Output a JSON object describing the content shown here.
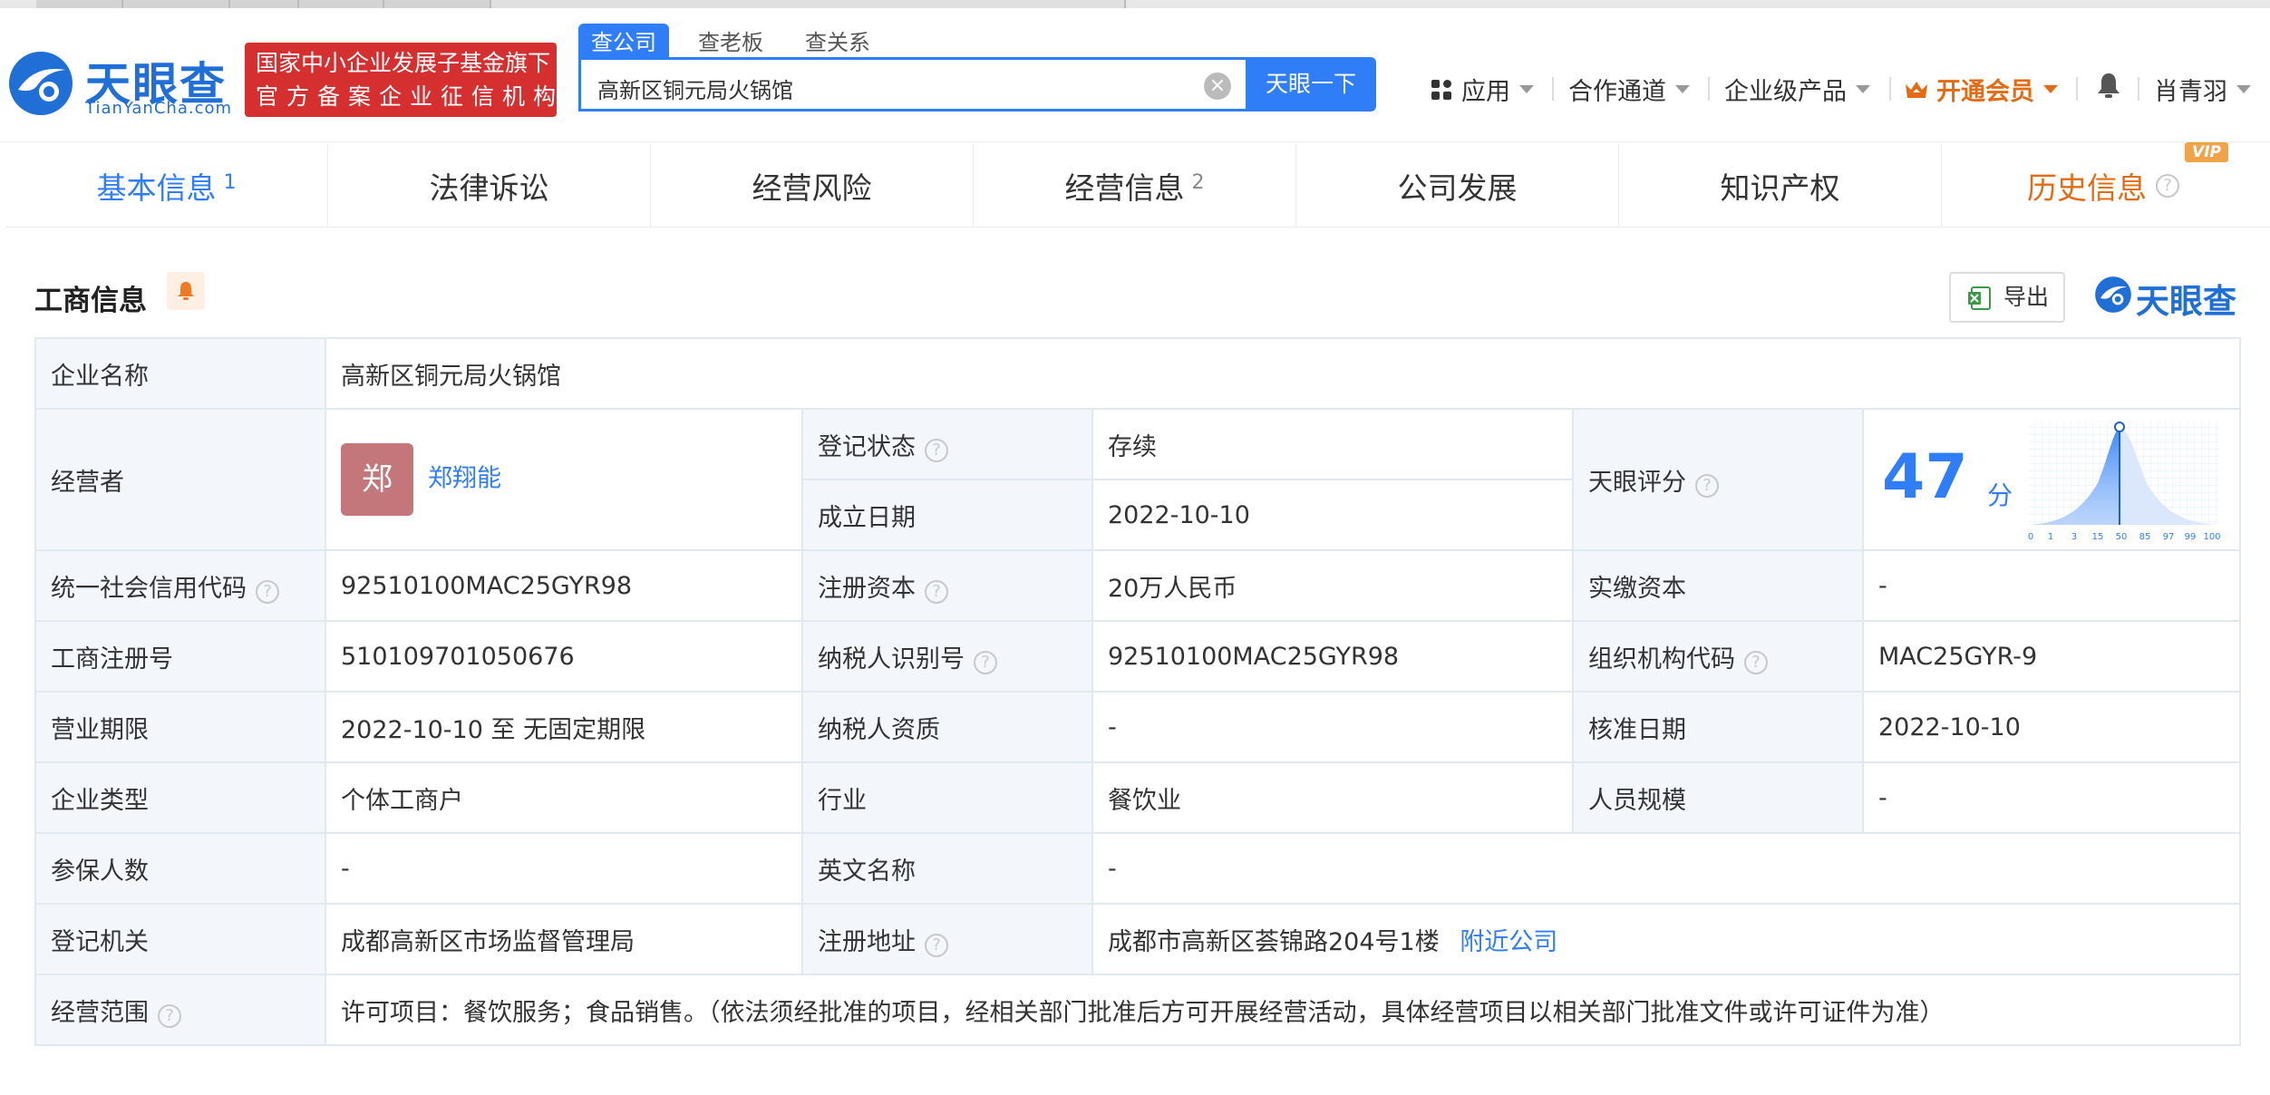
{
  "header": {
    "logo_text": "天眼查",
    "logo_sub": "TianYanCha.com",
    "badge_line1": "国家中小企业发展子基金旗下",
    "badge_line2": "官方备案企业征信机构",
    "search_tabs": [
      "查公司",
      "查老板",
      "查关系"
    ],
    "search_value": "高新区铜元局火锅馆",
    "search_button": "天眼一下",
    "nav": {
      "apps": "应用",
      "partner": "合作通道",
      "enterprise": "企业级产品",
      "vip": "开通会员",
      "user": "肖青羽"
    }
  },
  "tabs": [
    {
      "label": "基本信息",
      "count": "1"
    },
    {
      "label": "法律诉讼",
      "count": ""
    },
    {
      "label": "经营风险",
      "count": ""
    },
    {
      "label": "经营信息",
      "count": "2"
    },
    {
      "label": "公司发展",
      "count": ""
    },
    {
      "label": "知识产权",
      "count": ""
    },
    {
      "label": "历史信息",
      "count": "",
      "badge": "VIP"
    }
  ],
  "section": {
    "title": "工商信息",
    "export": "导出",
    "brand": "天眼查"
  },
  "info": {
    "company_name_label": "企业名称",
    "company_name": "高新区铜元局火锅馆",
    "operator_label": "经营者",
    "operator_avatar": "郑",
    "operator_name": "郑翔能",
    "reg_status_label": "登记状态",
    "reg_status": "存续",
    "est_date_label": "成立日期",
    "est_date": "2022-10-10",
    "score_label": "天眼评分",
    "score": "47",
    "score_unit": "分",
    "score_ticks": [
      "0",
      "1",
      "3",
      "15",
      "50",
      "85",
      "97",
      "99",
      "100"
    ],
    "credit_code_label": "统一社会信用代码",
    "credit_code": "92510100MAC25GYR98",
    "reg_capital_label": "注册资本",
    "reg_capital": "20万人民币",
    "paid_capital_label": "实缴资本",
    "paid_capital": "-",
    "reg_no_label": "工商注册号",
    "reg_no": "510109701050676",
    "taxpayer_id_label": "纳税人识别号",
    "taxpayer_id": "92510100MAC25GYR98",
    "org_code_label": "组织机构代码",
    "org_code": "MAC25GYR-9",
    "term_label": "营业期限",
    "term": "2022-10-10 至 无固定期限",
    "taxpayer_qual_label": "纳税人资质",
    "taxpayer_qual": "-",
    "approval_date_label": "核准日期",
    "approval_date": "2022-10-10",
    "type_label": "企业类型",
    "type": "个体工商户",
    "industry_label": "行业",
    "industry": "餐饮业",
    "staff_label": "人员规模",
    "staff": "-",
    "insured_label": "参保人数",
    "insured": "-",
    "english_name_label": "英文名称",
    "english_name": "-",
    "authority_label": "登记机关",
    "authority": "成都高新区市场监督管理局",
    "address_label": "注册地址",
    "address": "成都市高新区荟锦路204号1楼",
    "nearby": "附近公司",
    "scope_label": "经营范围",
    "scope": "许可项目：餐饮服务；食品销售。（依法须经批准的项目，经相关部门批准后方可开展经营活动，具体经营项目以相关部门批准文件或许可证件为准）"
  },
  "colors": {
    "brand_blue": "#2f7ef7",
    "badge_red": "#d62f2f",
    "vip_orange": "#e36b14",
    "status_green": "#47a34f",
    "label_bg": "#f3f7fc"
  }
}
